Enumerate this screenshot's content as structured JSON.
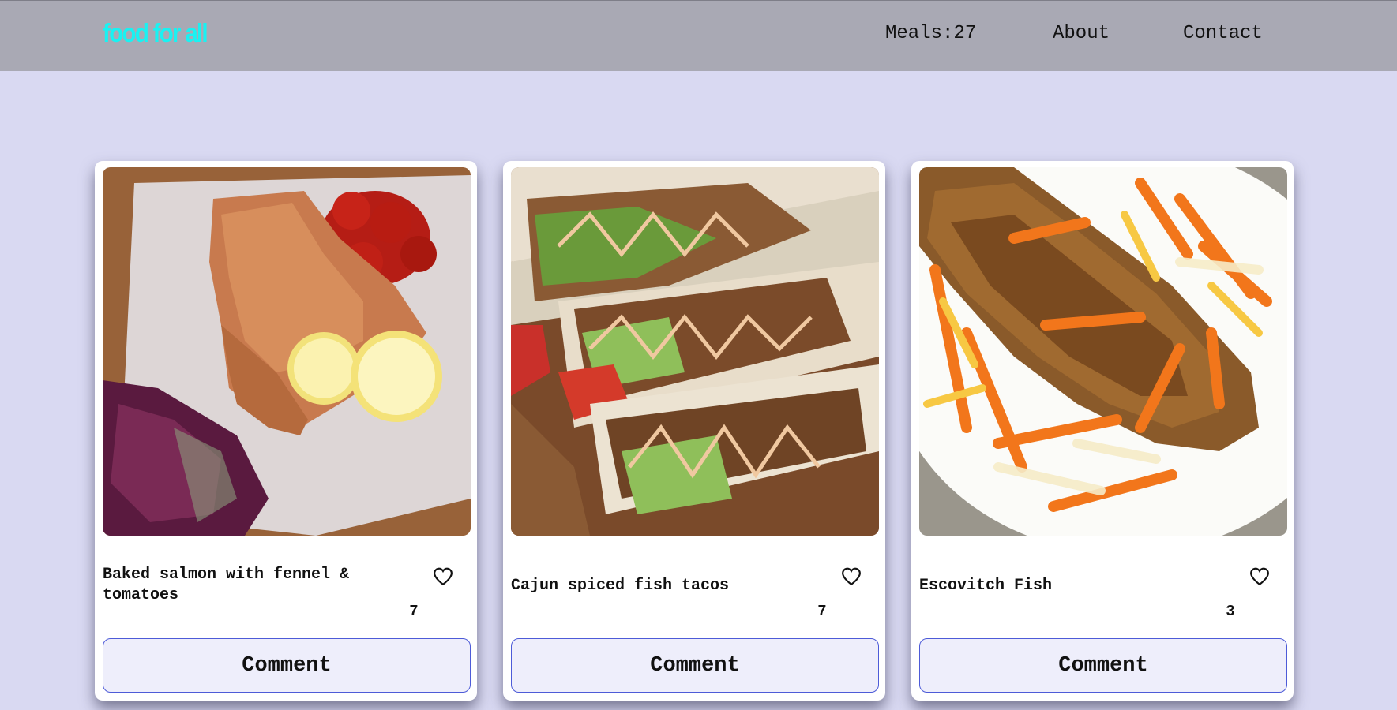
{
  "header": {
    "logo": "food for all",
    "nav": {
      "meals": "Meals:27",
      "about": "About",
      "contact": "Contact"
    }
  },
  "cards": [
    {
      "title": "Baked salmon with fennel & tomatoes",
      "likes": "7",
      "comment_label": "Comment",
      "image": "baked salmon with tomatoes, lemon and cabbage"
    },
    {
      "title": "Cajun spiced fish tacos",
      "likes": "7",
      "comment_label": "Comment",
      "image": "fish tacos with sauce drizzle"
    },
    {
      "title": "Escovitch Fish",
      "likes": "3",
      "comment_label": "Comment",
      "image": "fried fish with pickled carrots and onions"
    }
  ],
  "icons": {
    "like": "heart-outline-icon"
  },
  "colors": {
    "logo": "#19f2f2",
    "navbar": "#a9a9b4",
    "page_bg": "#d9d9f2",
    "button_bg": "#eeeefb",
    "button_border": "#4d5bd8"
  }
}
